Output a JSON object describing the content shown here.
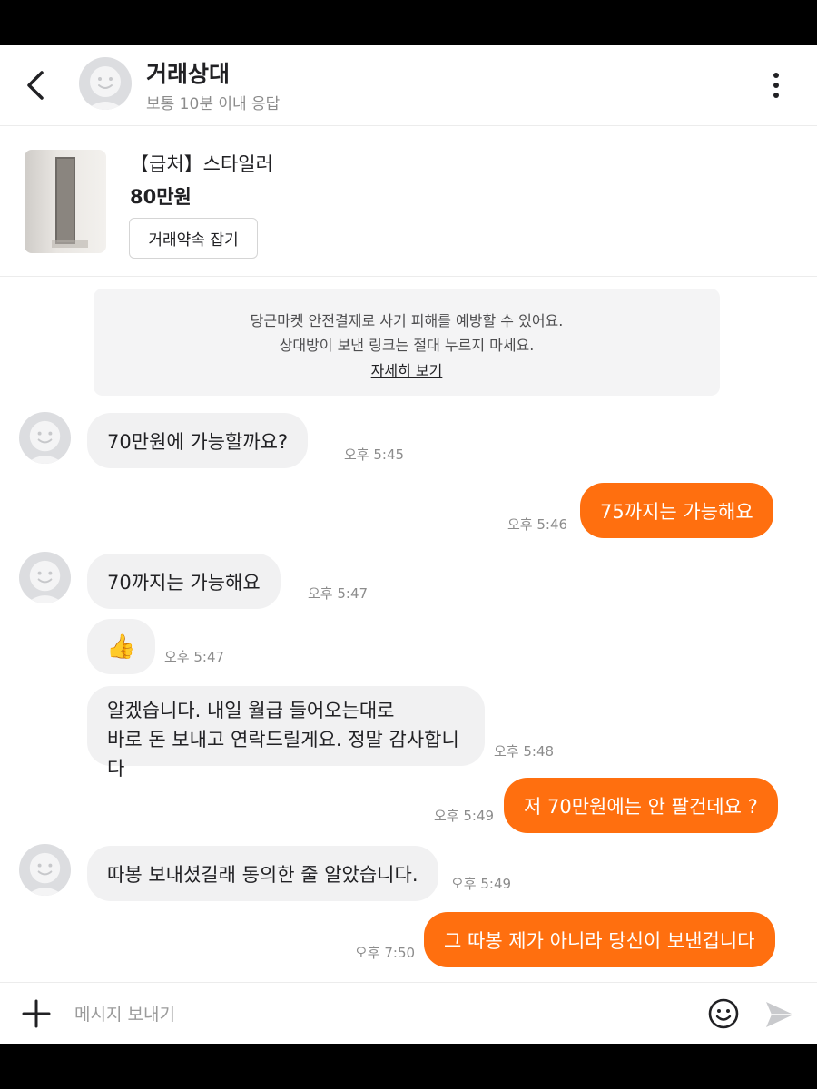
{
  "header": {
    "title": "거래상대",
    "subtitle": "보통 10분 이내 응답"
  },
  "product": {
    "name": "【급처】스타일러",
    "price": "80만원",
    "deal_button": "거래약속 잡기"
  },
  "notice": {
    "line1": "당근마켓 안전결제로 사기 피해를 예방할 수 있어요.",
    "line2": "상대방이 보낸 링크는 절대 누르지 마세요.",
    "link": "자세히 보기"
  },
  "messages": [
    {
      "side": "in",
      "text": "70만원에 가능할까요?",
      "time": "오후 5:45"
    },
    {
      "side": "out",
      "text": "75까지는 가능해요",
      "time": "오후 5:46"
    },
    {
      "side": "in",
      "text": "70까지는 가능해요",
      "time": "오후 5:47"
    },
    {
      "side": "in",
      "text": "👍",
      "time": "오후 5:47"
    },
    {
      "side": "in",
      "lines": [
        "알겠습니다. 내일 월급 들어오는대로",
        "바로 돈 보내고 연락드릴게요. 정말 감사합니다"
      ],
      "time": "오후 5:48"
    },
    {
      "side": "out",
      "text": "저 70만원에는 안 팔건데요 ?",
      "time": "오후 5:49"
    },
    {
      "side": "in",
      "text": "따봉 보내셨길래 동의한 줄 알았습니다.",
      "time": "오후 5:49"
    },
    {
      "side": "out",
      "text": "그 따봉 제가 아니라 당신이 보낸겁니다",
      "time": "오후 7:50"
    }
  ],
  "input": {
    "placeholder": "메시지 보내기"
  },
  "colors": {
    "accent": "#ff6f0f",
    "incoming_bubble": "#f1f1f2",
    "avatar": "#dcdde0"
  },
  "icons": [
    "back-arrow-icon",
    "more-vertical-icon",
    "plus-icon",
    "emoji-icon",
    "send-icon",
    "default-avatar-icon"
  ]
}
